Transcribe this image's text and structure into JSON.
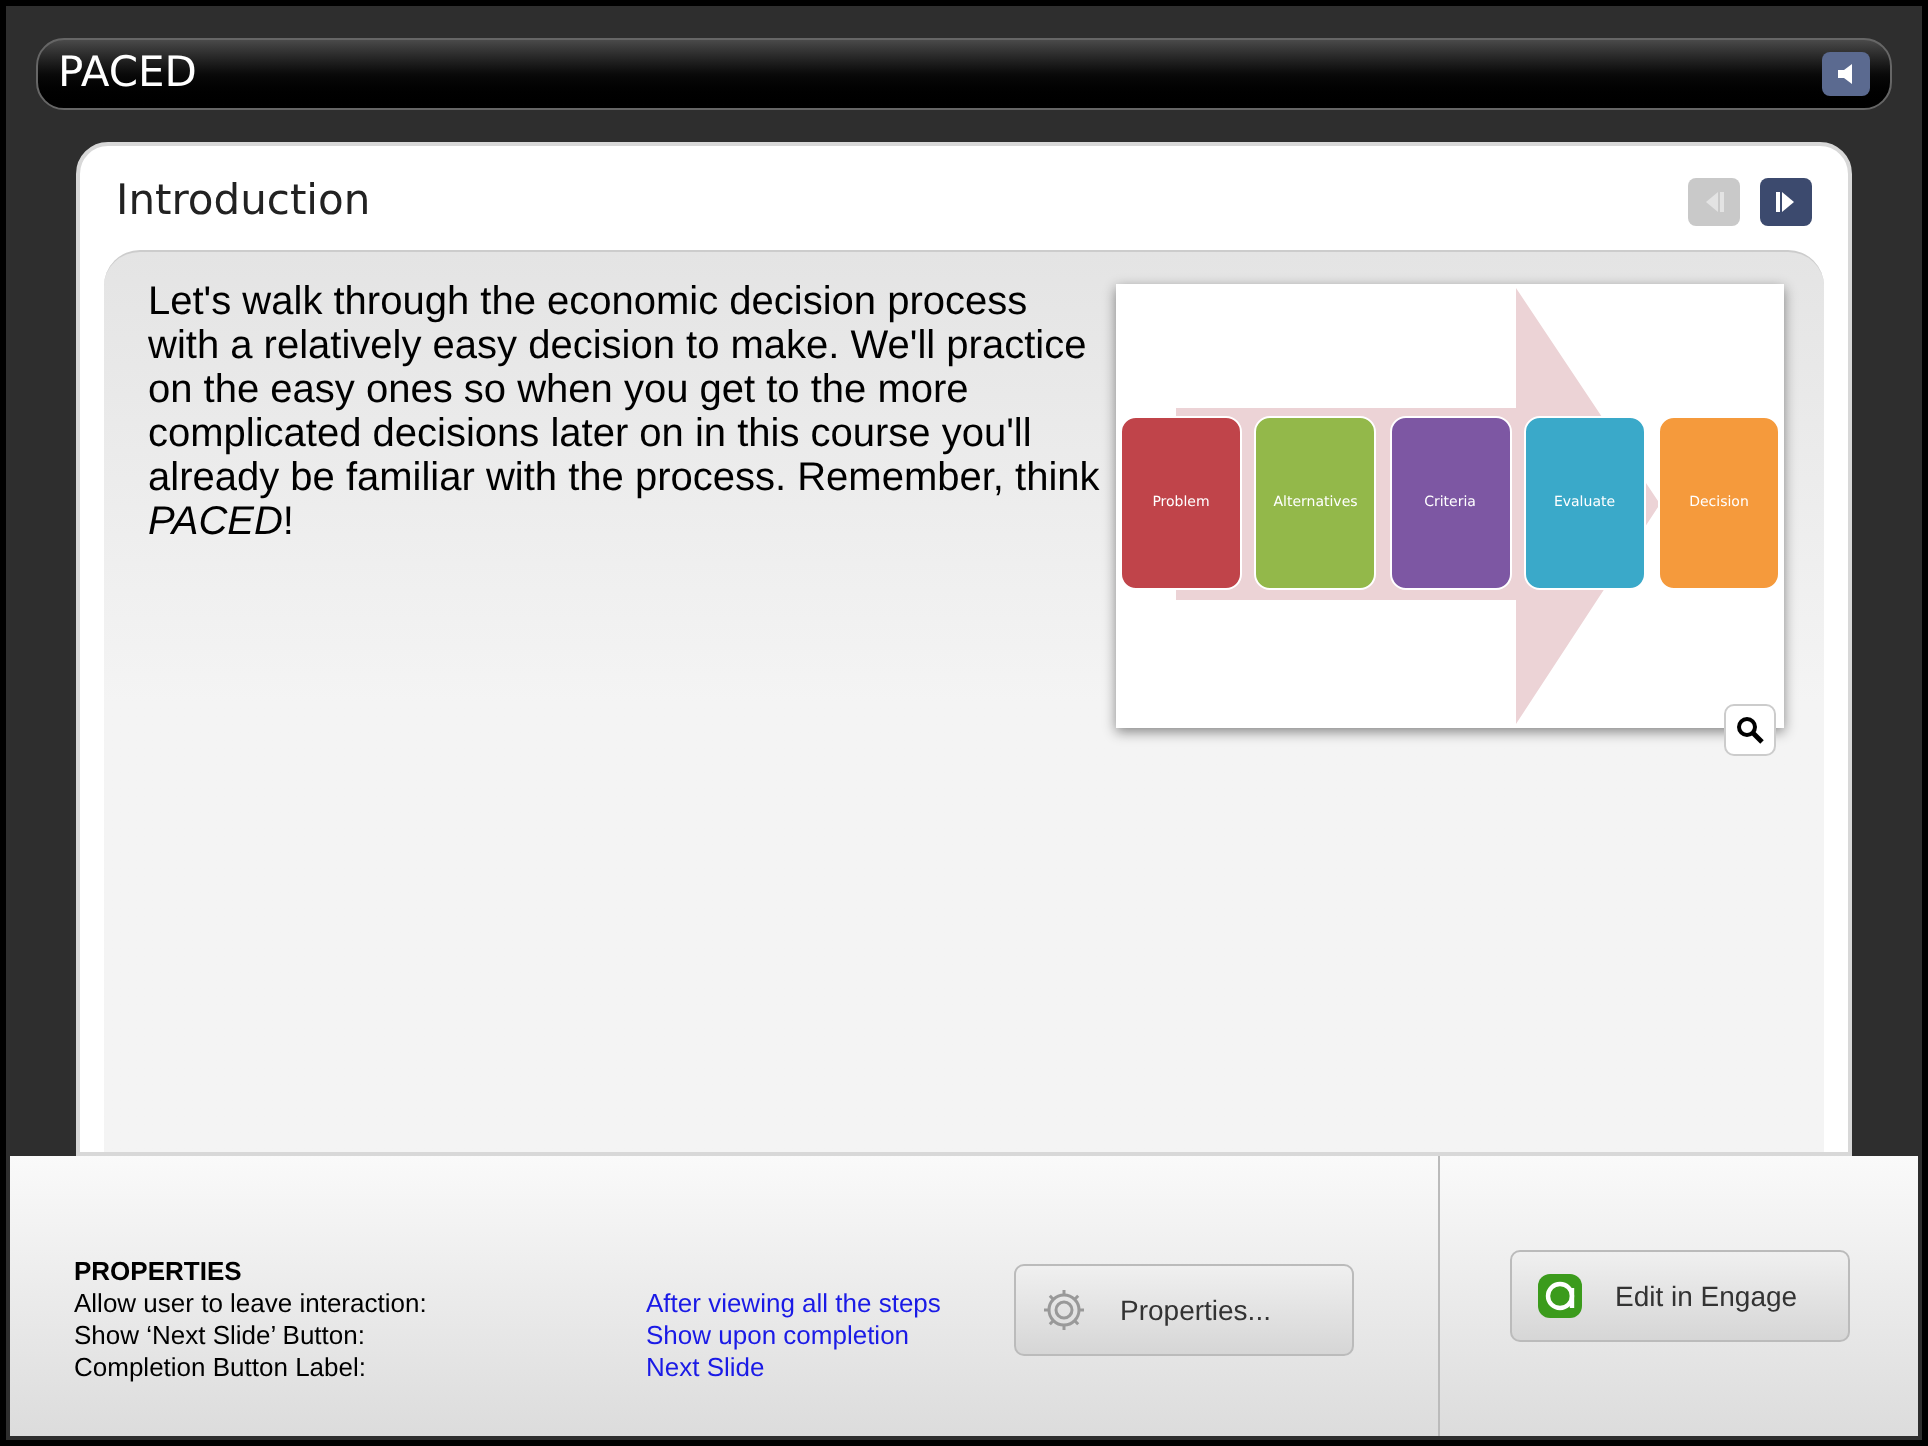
{
  "window": {
    "title": "PACED"
  },
  "slide": {
    "title": "Introduction",
    "nav": [
      {
        "kind": "previous",
        "disabled": true
      },
      {
        "kind": "next",
        "disabled": false
      }
    ],
    "body": "Let's walk through the economic decision process with a relatively easy decision to make. We'll practice on the easy ones so when you get to the more complicated decisions later on in this course you'll already be familiar with the process. Remember, think *PACED*!",
    "diagram": {
      "steps": [
        {
          "label": "Problem",
          "color": "#c0444a"
        },
        {
          "label": "Alternatives",
          "color": "#93b84a"
        },
        {
          "label": "Criteria",
          "color": "#7d57a3"
        },
        {
          "label": "Evaluate",
          "color": "#3aa9c9"
        },
        {
          "label": "Decision",
          "color": "#f59a3c"
        }
      ]
    }
  },
  "properties": {
    "heading": "PROPERTIES",
    "rows": [
      {
        "label": "Allow user to leave interaction:",
        "value": "After viewing all the steps"
      },
      {
        "label": "Show ‘Next Slide’ Button:",
        "value": "Show upon completion"
      },
      {
        "label": "Completion Button Label:",
        "value": "Next Slide"
      }
    ],
    "buttons": [
      {
        "kind": "properties",
        "label": "Properties..."
      },
      {
        "kind": "engage",
        "label": "Edit in Engage"
      }
    ]
  }
}
